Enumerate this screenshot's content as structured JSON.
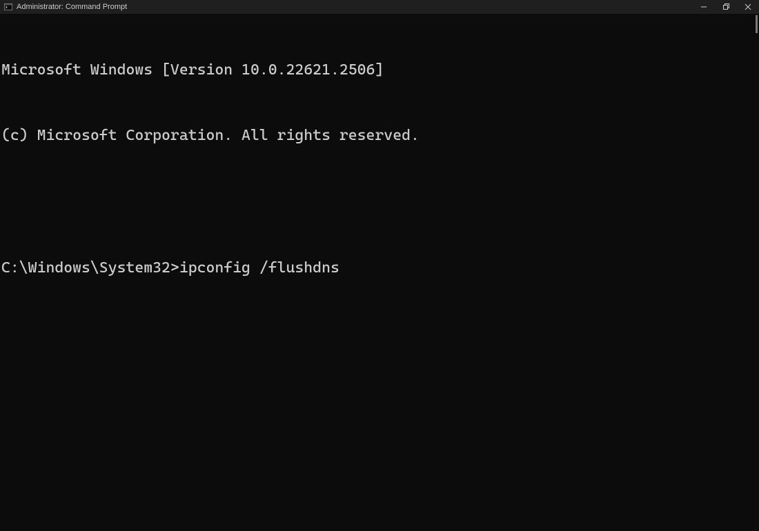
{
  "titlebar": {
    "title": "Administrator: Command Prompt",
    "icons": {
      "app": "cmd-icon",
      "minimize": "minimize-icon",
      "maximize": "maximize-icon",
      "close": "close-icon"
    }
  },
  "terminal": {
    "banner_line1": "Microsoft Windows [Version 10.0.22621.2506]",
    "banner_line2": "(c) Microsoft Corporation. All rights reserved.",
    "prompt": "C:\\Windows\\System32>",
    "command": "ipconfig /flushdns"
  },
  "colors": {
    "background": "#0c0c0c",
    "titlebar": "#1f1f1f",
    "text": "#cccccc"
  }
}
